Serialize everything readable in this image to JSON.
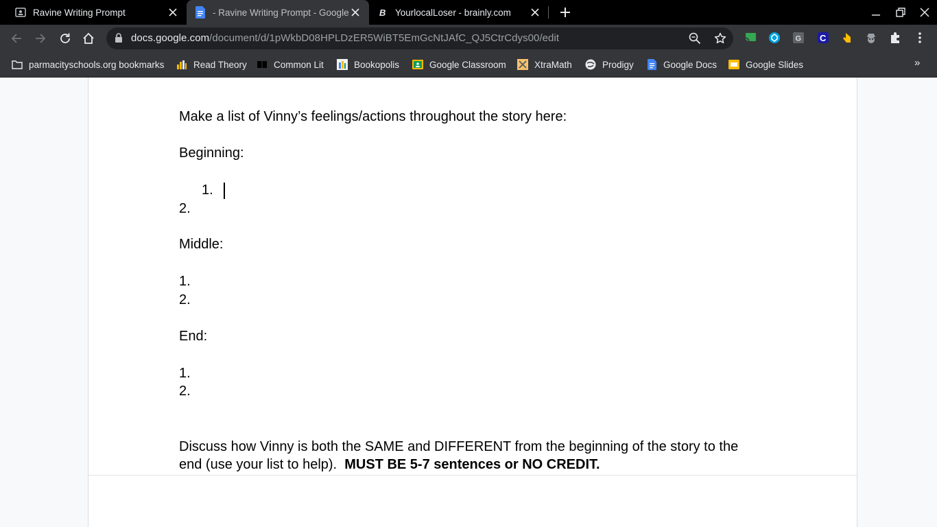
{
  "browser": {
    "tabs": [
      {
        "title": "Ravine Writing Prompt",
        "icon": "classroom-assignment-icon",
        "active": false
      },
      {
        "title": "- Ravine Writing Prompt - Google Docs",
        "icon": "google-docs-icon",
        "active": true
      },
      {
        "title": "YourlocalLoser - brainly.com",
        "icon": "brainly-icon",
        "active": false
      }
    ],
    "url_host": "docs.google.com",
    "url_path": "/document/d/1pWkbD08HPLDzER5WiBT5EmGcNtJAfC_QJ5CtrCdys00/edit",
    "bookmarks": [
      {
        "label": "parmacityschools.org bookmarks",
        "icon": "folder-icon"
      },
      {
        "label": "Read Theory",
        "icon": "read-theory-icon"
      },
      {
        "label": "Common Lit",
        "icon": "book-icon"
      },
      {
        "label": "Bookopolis",
        "icon": "bookopolis-icon"
      },
      {
        "label": "Google Classroom",
        "icon": "google-classroom-icon"
      },
      {
        "label": "XtraMath",
        "icon": "xtramath-icon"
      },
      {
        "label": "Prodigy",
        "icon": "prodigy-icon"
      },
      {
        "label": "Google Docs",
        "icon": "google-docs-icon"
      },
      {
        "label": "Google Slides",
        "icon": "google-slides-icon"
      }
    ],
    "more_bookmarks": "»"
  },
  "document": {
    "instruction": "Make a list of Vinny’s feelings/actions throughout the story here:",
    "beginning_heading": "Beginning:",
    "beginning_items": [
      "1.",
      "2."
    ],
    "middle_heading": "Middle:",
    "middle_items": [
      "1.",
      "2."
    ],
    "end_heading": "End:",
    "end_items": [
      "1.",
      "2."
    ],
    "discuss_line1": "Discuss how Vinny is both the SAME and DIFFERENT from the beginning of the story to the",
    "discuss_line2_plain": "end (use your list to help).",
    "discuss_line2_bold": "MUST BE 5-7 sentences or NO CREDIT."
  },
  "colors": {
    "tab_strip": "#000000",
    "toolbar": "#35363a",
    "omnibox": "#202124",
    "docs_blue": "#4285f4",
    "slides_yellow": "#fbbc04",
    "classroom_green": "#0f9d58"
  }
}
